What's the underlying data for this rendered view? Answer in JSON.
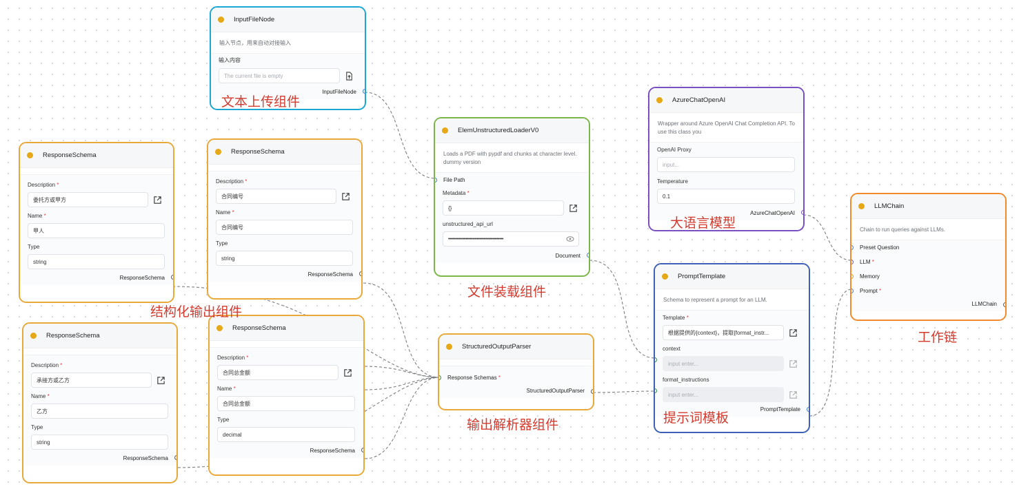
{
  "colors": {
    "input_file_border": "#1aa7d4",
    "loader_border": "#7ab648",
    "schema_border": "#e8a93a",
    "parser_border": "#e8a93a",
    "azure_border": "#7a4fc2",
    "prompt_border": "#3d5fb8",
    "chain_border": "#f08a2c",
    "annotation": "#d43b2f"
  },
  "input_file": {
    "title": "InputFileNode",
    "desc": "输入节点，用来自动对接输入",
    "content_label": "输入内容",
    "file_placeholder": "The current file is empty",
    "output": "InputFileNode",
    "icon": "file-upload-icon"
  },
  "loader": {
    "title": "ElemUnstructuredLoaderV0",
    "desc": "Loads a PDF with pypdf and chunks at character level. dummy version",
    "file_path": "File Path",
    "metadata_label": "Metadata",
    "metadata_value": "{}",
    "api_url_label": "unstructured_api_url",
    "api_url_value": "•••••••••••••••••••••••••••••••••••••••••",
    "output": "Document",
    "icon": "eye-icon"
  },
  "schema_a": {
    "title": "ResponseSchema",
    "desc_label": "Description",
    "desc_value": "委托方或甲方",
    "name_label": "Name",
    "name_value": "甲人",
    "type_label": "Type",
    "type_value": "string",
    "output": "ResponseSchema"
  },
  "schema_b": {
    "title": "ResponseSchema",
    "desc_label": "Description",
    "desc_value": "合同编号",
    "name_label": "Name",
    "name_value": "合同编号",
    "type_label": "Type",
    "type_value": "string",
    "output": "ResponseSchema"
  },
  "schema_c": {
    "title": "ResponseSchema",
    "desc_label": "Description",
    "desc_value": "承接方或乙方",
    "name_label": "Name",
    "name_value": "乙方",
    "type_label": "Type",
    "type_value": "string",
    "output": "ResponseSchema"
  },
  "schema_d": {
    "title": "ResponseSchema",
    "desc_label": "Description",
    "desc_value": "合同总金额",
    "name_label": "Name",
    "name_value": "合同总金额",
    "type_label": "Type",
    "type_value": "decimal",
    "output": "ResponseSchema"
  },
  "parser": {
    "title": "StructuredOutputParser",
    "input_label": "Response Schemas",
    "output": "StructuredOutputParser"
  },
  "azure": {
    "title": "AzureChatOpenAI",
    "desc": "Wrapper around Azure OpenAI Chat Completion API. To use this class you",
    "proxy_label": "OpenAI Proxy",
    "proxy_placeholder": "input...",
    "temp_label": "Temperature",
    "temp_value": "0.1",
    "output": "AzureChatOpenAI"
  },
  "prompt": {
    "title": "PromptTemplate",
    "desc": "Schema to represent a prompt for an LLM.",
    "template_label": "Template",
    "template_value": "根据提供的{context}，提取{format_instr...",
    "context_label": "context",
    "context_placeholder": "input enter...",
    "format_label": "format_instructions",
    "format_placeholder": "input enter...",
    "output": "PromptTemplate"
  },
  "chain": {
    "title": "LLMChain",
    "desc": "Chain to run queries against LLMs.",
    "preset_label": "Preset Question",
    "llm_label": "LLM",
    "memory_label": "Memory",
    "prompt_label": "Prompt",
    "output": "LLMChain"
  },
  "annotations": {
    "upload": "文本上传组件",
    "loader": "文件装载组件",
    "schema": "结构化输出组件",
    "parser": "输出解析器组件",
    "llm": "大语言模型",
    "prompt": "提示词模板",
    "chain": "工作链"
  },
  "icons": {
    "external": "external-link-icon",
    "status": "status-dot"
  }
}
